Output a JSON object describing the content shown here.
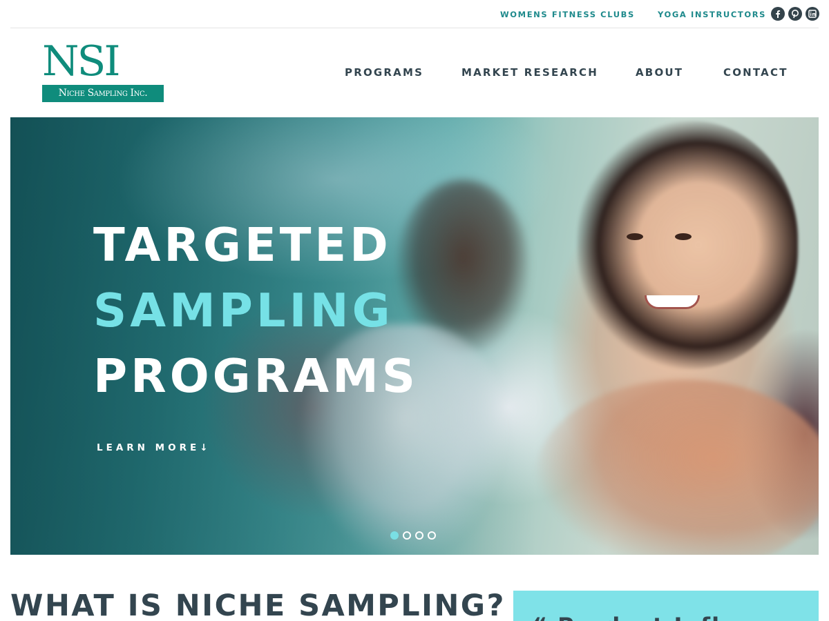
{
  "utility": {
    "links": [
      "WOMENS FITNESS CLUBS",
      "YOGA INSTRUCTORS"
    ],
    "social": [
      "facebook-icon",
      "pinterest-icon",
      "linkedin-icon"
    ],
    "color": "#1f8a8c"
  },
  "logo": {
    "mark": "NSI",
    "name": "Niche Sampling Inc.",
    "color": "#0f8c7c"
  },
  "nav": {
    "programs": "PROGRAMS",
    "market_research": "MARKET RESEARCH",
    "about": "ABOUT",
    "contact": "CONTACT"
  },
  "hero": {
    "line1": "TARGETED",
    "line2": "SAMPLING",
    "line3": "PROGRAMS",
    "cta": "LEARN MORE↓",
    "accent_color": "#76e1e6",
    "slides_total": 4,
    "active_slide": 1
  },
  "section": {
    "title": "WHAT IS NICHE SAMPLING?",
    "quote_fragment": "“ Product Infl"
  }
}
